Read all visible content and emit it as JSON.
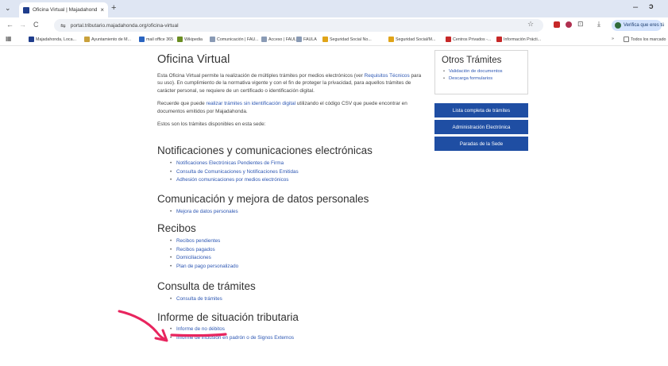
{
  "browser": {
    "tab": {
      "title": "Oficina Virtual | Majadahonda",
      "close": "×"
    },
    "tab_menu": "⌄",
    "new_tab": "+",
    "window": {
      "minimize": "–",
      "maximize": "ɔ"
    },
    "nav": {
      "back": "←",
      "forward": "→",
      "reload": "C"
    },
    "omnibox": {
      "site_icon": "⇋",
      "url": "portal.tributario.majadahonda.org/oficina-virtual"
    },
    "toolbar_glyphs": {
      "star": "☆",
      "extensions": "⊡",
      "download": "⤓"
    },
    "profile_pill": "Verifica que eres tú",
    "bookmarks": [
      {
        "label": "Majadahonda, Loca...",
        "color": "#1f3d8c"
      },
      {
        "label": "Ayuntamiento de M...",
        "color": "#c9a13b"
      },
      {
        "label": "mail office 365",
        "color": "#2a64c0"
      },
      {
        "label": "Wikipedia",
        "color": "#6b8e23"
      },
      {
        "label": "Comunicación | FAU...",
        "color": "#8a9bb5"
      },
      {
        "label": "Acceso | FAULA",
        "color": "#8a9bb5"
      },
      {
        "label": "FAULA",
        "color": "#8a9bb5"
      },
      {
        "label": "Seguridad Social No...",
        "color": "#e0a419"
      },
      {
        "label": "Seguridad Social/M...",
        "color": "#e0a419"
      },
      {
        "label": "Centros Privados -...",
        "color": "#c62828"
      },
      {
        "label": "Información Prácti...",
        "color": "#c62828"
      }
    ],
    "bookmarks_more": "»",
    "all_bookmarks": "Todos los marcado"
  },
  "page": {
    "title": "Oficina Virtual",
    "intro_1_before": "Esta Oficina Virtual permite la realización de múltiples trámites por medios electrónicos (ver ",
    "intro_1_link": "Requisitos Técnicos",
    "intro_1_after": " para su uso). En cumplimiento de la normativa vigente y con el fin de proteger la privacidad, para aquellos trámites de carácter personal, se requiere de un certificado o identificación digital.",
    "intro_2_before": "Recuerde que puede ",
    "intro_2_link": "realizar trámites sin identificación digital",
    "intro_2_after": " utilizando el código CSV que puede encontrar en documentos emitidos por Majadahonda.",
    "intro_3": "Estos son los trámites disponibles en esta sede:",
    "sections": [
      {
        "title": "Notificaciones y comunicaciones electrónicas",
        "items": [
          "Notificaciones Electrónicas Pendientes de Firma",
          "Consulta de Comunicaciones y Notificaciones Emitidas",
          "Adhesión comunicaciones por medios electrónicos"
        ]
      },
      {
        "title": "Comunicación y mejora de datos personales",
        "items": [
          "Mejora de datos personales"
        ]
      },
      {
        "title": "Recibos",
        "items": [
          "Recibos pendientes",
          "Recibos pagados",
          "Domiciliaciones",
          "Plan de pago personalizado"
        ]
      },
      {
        "title": "Consulta de trámites",
        "items": [
          "Consulta de trámites"
        ]
      },
      {
        "title": "Informe de situación tributaria",
        "items": [
          "Informe de no débitos",
          "Informe de inclusión en padrón o de Signos Externos"
        ]
      }
    ]
  },
  "aside": {
    "title": "Otros Trámites",
    "links": [
      "Validación de documentos",
      "Descarga formularios"
    ],
    "buttons": [
      "Lista completa de trámites",
      "Administración Electrónica",
      "Paradas de la Sede"
    ]
  },
  "annotation": {
    "color": "#e8255e"
  }
}
